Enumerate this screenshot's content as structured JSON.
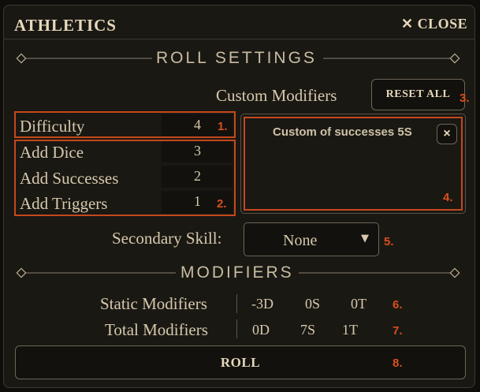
{
  "window": {
    "title": "ATHLETICS",
    "close_label": "CLOSE"
  },
  "roll_settings": {
    "section_title": "ROLL SETTINGS",
    "custom_modifiers_label": "Custom Modifiers",
    "reset_all_label": "RESET ALL",
    "difficulty": {
      "label": "Difficulty",
      "value": "4"
    },
    "add_dice": {
      "label": "Add Dice",
      "value": "3"
    },
    "add_successes": {
      "label": "Add Successes",
      "value": "2"
    },
    "add_triggers": {
      "label": "Add Triggers",
      "value": "1"
    },
    "custom_modifier_items": [
      {
        "label": "Custom of successes 5S",
        "remove_glyph": "×"
      }
    ],
    "secondary_skill": {
      "label": "Secondary Skill:",
      "selected": "None"
    }
  },
  "modifiers": {
    "section_title": "MODIFIERS",
    "static": {
      "label": "Static Modifiers",
      "dice": "-3D",
      "successes": "0S",
      "triggers": "0T"
    },
    "total": {
      "label": "Total Modifiers",
      "dice": "0D",
      "successes": "7S",
      "triggers": "1T"
    }
  },
  "roll_label": "ROLL",
  "annotations": [
    "1.",
    "2.",
    "3.",
    "4.",
    "5.",
    "6.",
    "7.",
    "8."
  ],
  "colors": {
    "accent": "#c4491d",
    "background": "#1a1813",
    "text": "#c9bda3"
  },
  "icons": {
    "close": "close-icon",
    "dropdown": "caret-down-icon",
    "divider": "diamond-icon"
  }
}
